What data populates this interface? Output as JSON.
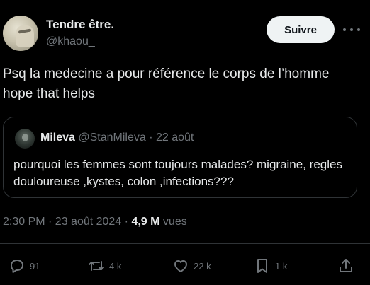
{
  "author": {
    "name": "Tendre être.",
    "handle": "@khaou_"
  },
  "follow_button": {
    "label": "Suivre"
  },
  "tweet": {
    "text": "Psq la medecine a pour référence le corps de l’homme hope that helps"
  },
  "quoted": {
    "name": "Mileva",
    "handle": "@StanMileva",
    "date": "· 22 août",
    "text": "pourquoi les femmes sont toujours malades? migraine, regles douloureuse ,kystes, colon ,infections???"
  },
  "meta": {
    "time_date": "2:30 PM · 23 août 2024 · ",
    "views": "4,9 M",
    "views_label": " vues"
  },
  "actions": {
    "replies": "91",
    "reposts": "4 k",
    "likes": "22 k",
    "bookmarks": "1 k"
  },
  "icons": [
    "more-icon",
    "reply-icon",
    "repost-icon",
    "like-icon",
    "bookmark-icon",
    "share-icon"
  ],
  "colors": {
    "background": "#000000",
    "text": "#e7e9ea",
    "secondary": "#71767b",
    "border": "#2f3336",
    "button_bg": "#eff3f4"
  }
}
